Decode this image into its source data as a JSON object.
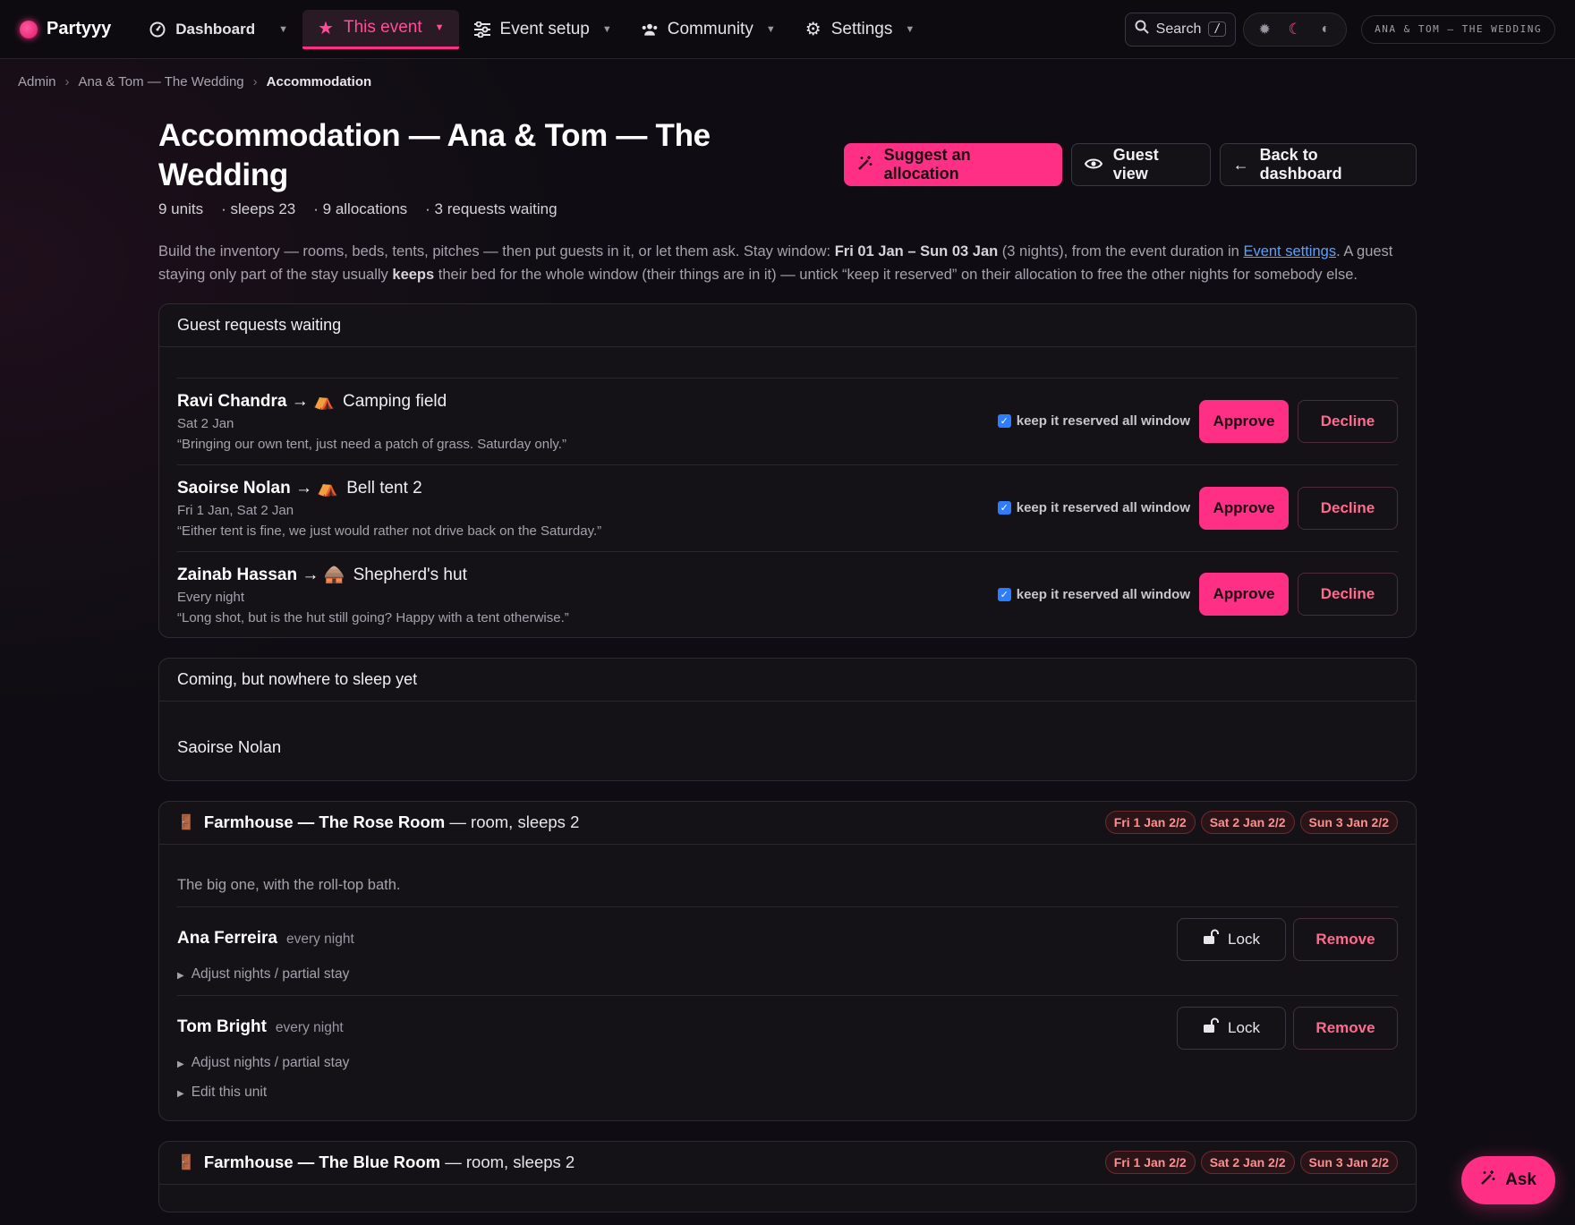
{
  "nav": {
    "brand": "Partyyy",
    "items": [
      {
        "label": "Dashboard"
      },
      {
        "label": "This event"
      },
      {
        "label": "Event setup"
      },
      {
        "label": "Community"
      },
      {
        "label": "Settings"
      }
    ],
    "search_label": "Search",
    "search_shortcut": "/",
    "event_pill": "ANA & TOM — THE WEDDING"
  },
  "breadcrumb": [
    "Admin",
    "Ana & Tom — The Wedding",
    "Accommodation"
  ],
  "header": {
    "title": "Accommodation — Ana & Tom — The Wedding",
    "stats": [
      "9 units",
      "· sleeps 23",
      "· 9 allocations",
      "· 3 requests waiting"
    ],
    "suggest_label": "Suggest an allocation",
    "guest_view_label": "Guest view",
    "back_label": "Back to dashboard"
  },
  "intro": {
    "p1": "Build the inventory — rooms, beds, tents, pitches — then put guests in it, or let them ask. Stay window: ",
    "window": "Fri 01 Jan – Sun 03 Jan",
    "p2": " (3 nights), from the event duration in ",
    "link": "Event settings",
    "p3": ". A guest staying only part of the stay usually ",
    "keeps": "keeps",
    "p4": " their bed for the whole window (their things are in it) — untick “keep it reserved” on their allocation to free the other nights for somebody else."
  },
  "requests": {
    "title": "Guest requests waiting",
    "keep_label": "keep it reserved all window",
    "approve_label": "Approve",
    "decline_label": "Decline",
    "items": [
      {
        "name": "Ravi Chandra",
        "arrow": "→",
        "icon": "⛺",
        "unit": "Camping field",
        "nights": "Sat 2 Jan",
        "note": "“Bringing our own tent, just need a patch of grass. Saturday only.”"
      },
      {
        "name": "Saoirse Nolan",
        "arrow": "→",
        "icon": "⛺",
        "unit": "Bell tent 2",
        "nights": "Fri 1 Jan, Sat 2 Jan",
        "note": "“Either tent is fine, we just would rather not drive back on the Saturday.”"
      },
      {
        "name": "Zainab Hassan",
        "arrow": "→",
        "icon": "🛖",
        "unit": "Shepherd's hut",
        "nights": "Every night",
        "note": "“Long shot, but is the hut still going? Happy with a tent otherwise.”"
      }
    ]
  },
  "unassigned": {
    "title": "Coming, but nowhere to sleep yet",
    "names": [
      "Saoirse Nolan"
    ]
  },
  "units": [
    {
      "icon": "🚪",
      "name": "Farmhouse — The Rose Room",
      "kind": " — room, sleeps 2",
      "chips": [
        "Fri 1 Jan 2/2",
        "Sat 2 Jan 2/2",
        "Sun 3 Jan 2/2"
      ],
      "desc": "The big one, with the roll-top bath.",
      "guests": [
        {
          "name": "Ana Ferreira",
          "nights": "every night",
          "adjust": "Adjust nights / partial stay"
        },
        {
          "name": "Tom Bright",
          "nights": "every night",
          "adjust": "Adjust nights / partial stay"
        }
      ],
      "edit": "Edit this unit"
    },
    {
      "icon": "🚪",
      "name": "Farmhouse — The Blue Room",
      "kind": " — room, sleeps 2",
      "chips": [
        "Fri 1 Jan 2/2",
        "Sat 2 Jan 2/2",
        "Sun 3 Jan 2/2"
      ]
    }
  ],
  "guest_actions": {
    "lock": "Lock",
    "remove": "Remove"
  },
  "ask_label": "Ask",
  "colors": {
    "accent": "#ff2f86",
    "background": "#0f0d13",
    "card": "#141217",
    "link": "#5aa0ff"
  }
}
